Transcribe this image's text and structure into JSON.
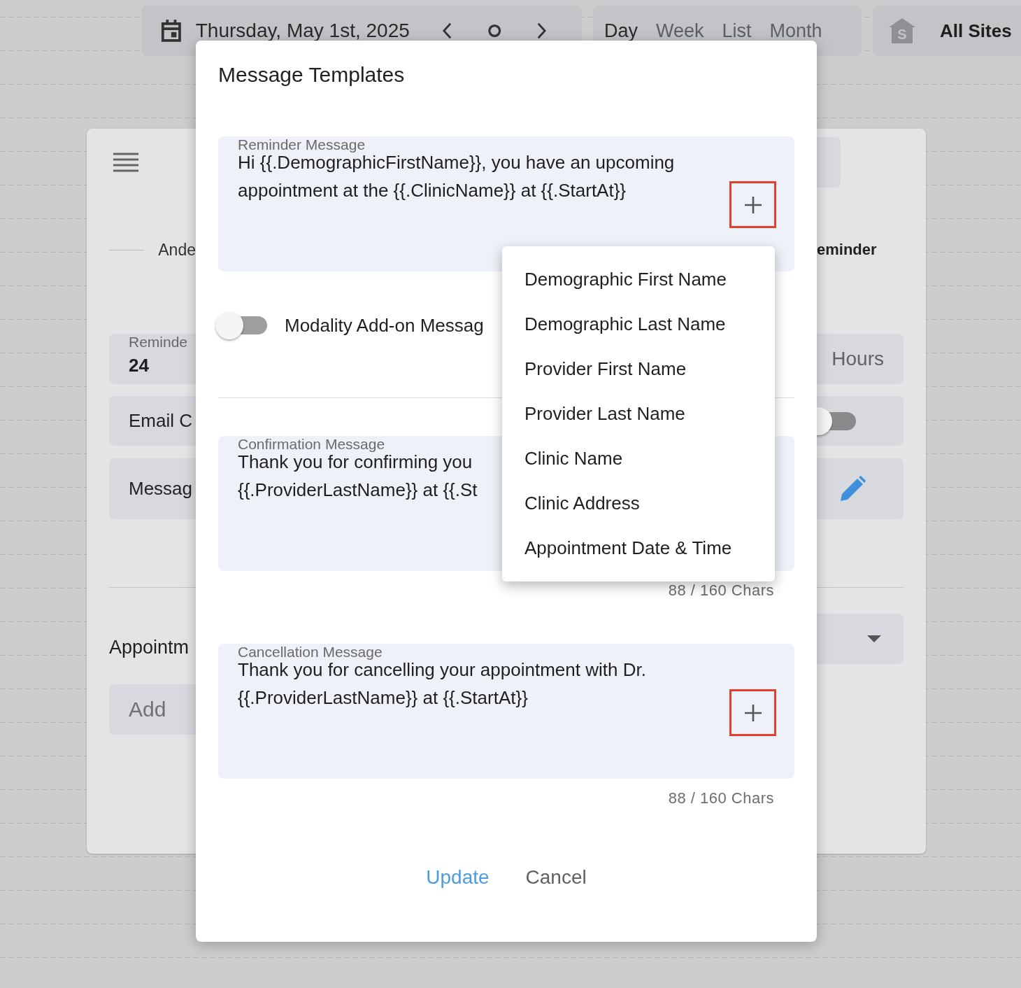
{
  "top_bar": {
    "date": "Thursday, May 1st, 2025",
    "views": [
      {
        "label": "Day",
        "selected": true
      },
      {
        "label": "Week",
        "selected": false
      },
      {
        "label": "List",
        "selected": false
      },
      {
        "label": "Month",
        "selected": false
      }
    ],
    "site_icon_letter": "S",
    "site": "All Sites"
  },
  "background_panel": {
    "left": {
      "partial_title": "Ande",
      "reminder_field": {
        "label": "Reminde",
        "value": "24"
      },
      "email_field": "Email C",
      "message_field": "Messag",
      "appointment_heading": "Appointm",
      "add_field": "Add"
    },
    "right": {
      "title": "eminder",
      "unit": "Hours",
      "toggle": {
        "on": false
      }
    }
  },
  "dialog": {
    "title": "Message Templates",
    "reminder_message": {
      "label": "Reminder Message",
      "lines": [
        "Hi {{.DemographicFirstName}}, you have an upcoming",
        "appointment at the {{.ClinicName}} at {{.StartAt}}"
      ],
      "add_button": true
    },
    "modality_toggle": {
      "label": "Modality Add-on Messag",
      "on": false
    },
    "confirmation_message": {
      "label": "Confirmation Message",
      "lines": [
        "Thank you for confirming you",
        "{{.ProviderLastName}} at {{.St"
      ],
      "add_button": false,
      "char_count": "88 / 160 Chars"
    },
    "cancellation_message": {
      "label": "Cancellation Message",
      "lines": [
        "Thank you for cancelling your appointment with Dr.",
        "{{.ProviderLastName}} at {{.StartAt}}"
      ],
      "add_button": true,
      "char_count": "88 / 160 Chars"
    },
    "menu": {
      "items": [
        "Demographic First Name",
        "Demographic Last Name",
        "Provider First Name",
        "Provider Last Name",
        "Clinic Name",
        "Clinic Address",
        "Appointment Date & Time"
      ]
    },
    "buttons": [
      {
        "label": "Update",
        "kind": "primary"
      },
      {
        "label": "Cancel",
        "kind": "secondary"
      }
    ]
  }
}
